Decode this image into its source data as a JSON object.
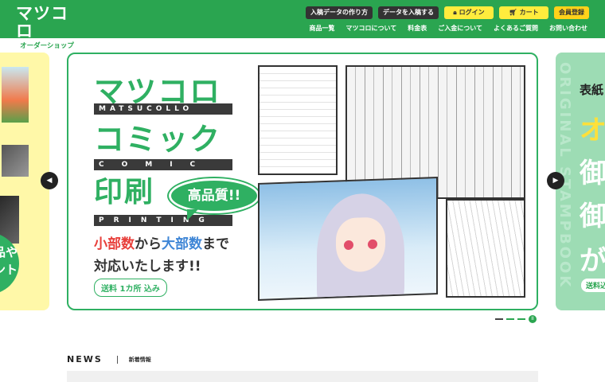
{
  "header": {
    "logo_main": "マツコロ",
    "logo_sub": "オーダーショップ",
    "top_buttons": [
      {
        "label": "入稿データの作り方",
        "icon": ""
      },
      {
        "label": "データを入稿する",
        "icon": ""
      },
      {
        "label": "ログイン",
        "icon": "lock-icon"
      },
      {
        "label": "カート",
        "icon": "cart-icon"
      },
      {
        "label": "会員登録",
        "icon": ""
      }
    ],
    "nav": [
      "商品一覧",
      "マツコロについて",
      "料金表",
      "ご入金について",
      "よくあるご質問",
      "お問い合わせ"
    ]
  },
  "slider": {
    "left_slide": {
      "text": "品や\nント\n。"
    },
    "main_slide": {
      "line1": "マツコロ",
      "bar1": "MATSUCOLLO",
      "line2": "コミック",
      "bar2": "COMIC",
      "line3": "印刷",
      "bar3": "PRINTING",
      "badge": "高品質!!",
      "catch1_a": "小部数",
      "catch1_b": "から",
      "catch1_c": "大部数",
      "catch1_d": "まで",
      "catch2": "対応いたします!!",
      "shipping": "送料 1カ所 込み"
    },
    "right_slide": {
      "vertical": "ORIGINAL STAMPBOOK",
      "t1": "表紙",
      "t2": "オ",
      "t3": "御",
      "t4": "御",
      "t5": "が",
      "tag": "送料込"
    },
    "prev_icon": "◀",
    "next_icon": "▶",
    "pager_play": "II"
  },
  "news": {
    "title": "NEWS",
    "subtitle": "新着情報"
  },
  "colors": {
    "brand_green": "#2aa550",
    "yellow": "#ffec3d",
    "orange_yellow": "#ffd21a",
    "dark": "#333333"
  }
}
